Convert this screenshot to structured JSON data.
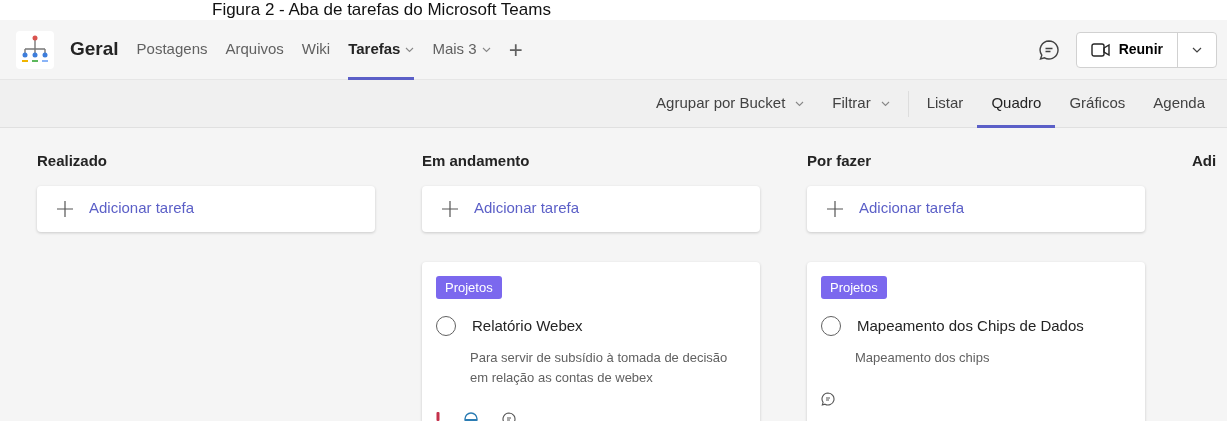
{
  "caption": "Figura 2 - Aba de tarefas do Microsoft Teams",
  "header": {
    "channel": "Geral",
    "tabs": [
      {
        "label": "Postagens",
        "selected": false,
        "dropdown": false
      },
      {
        "label": "Arquivos",
        "selected": false,
        "dropdown": false
      },
      {
        "label": "Wiki",
        "selected": false,
        "dropdown": false
      },
      {
        "label": "Tarefas",
        "selected": true,
        "dropdown": true
      },
      {
        "label": "Mais 3",
        "selected": false,
        "dropdown": true
      }
    ],
    "add_tab": "+",
    "meet_button": "Reunir"
  },
  "toolbar": {
    "group_by": "Agrupar por Bucket",
    "filter": "Filtrar",
    "views": [
      {
        "label": "Listar",
        "selected": false
      },
      {
        "label": "Quadro",
        "selected": true
      },
      {
        "label": "Gráficos",
        "selected": false
      },
      {
        "label": "Agenda",
        "selected": false
      }
    ]
  },
  "buckets": [
    {
      "name": "Realizado",
      "add_task": "Adicionar tarefa"
    },
    {
      "name": "Em andamento",
      "add_task": "Adicionar tarefa",
      "tasks": [
        {
          "label": "Projetos",
          "title": "Relatório Webex",
          "completed": false,
          "description": "Para servir de subsídio à tomada de decisão em relação as contas de webex",
          "important": true,
          "in_progress": true,
          "has_comments": true
        }
      ]
    },
    {
      "name": "Por fazer",
      "add_task": "Adicionar tarefa",
      "tasks": [
        {
          "label": "Projetos",
          "title": "Mapeamento dos Chips de Dados",
          "completed": false,
          "description": "Mapeamento dos chips",
          "important": false,
          "in_progress": false,
          "has_comments": true
        }
      ]
    },
    {
      "name": "Adi"
    }
  ]
}
